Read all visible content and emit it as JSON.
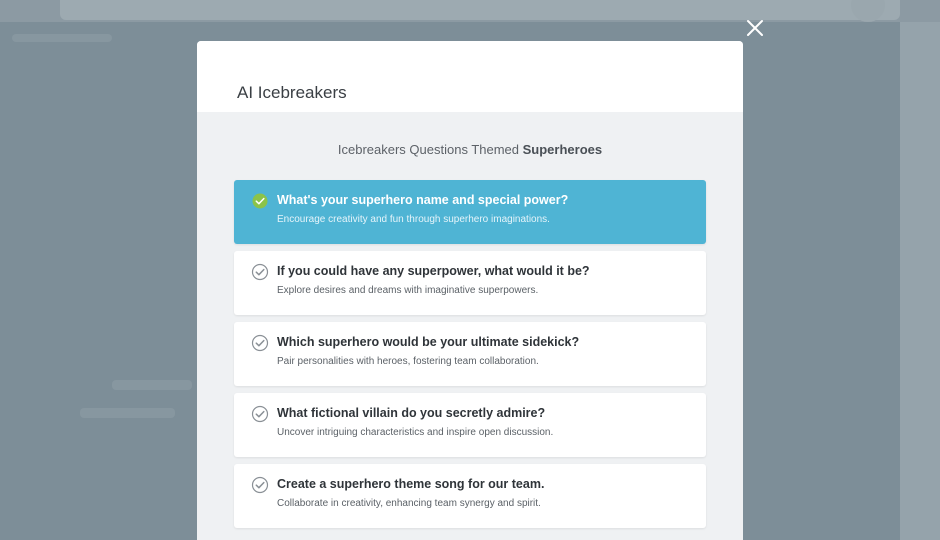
{
  "modal": {
    "title": "AI Icebreakers",
    "subtitle_prefix": "Icebreakers Questions Themed ",
    "subtitle_theme": "Superheroes"
  },
  "questions": [
    {
      "question": "What's your superhero name and special power?",
      "description": "Encourage creativity and fun through superhero imaginations.",
      "selected": true
    },
    {
      "question": "If you could have any superpower, what would it be?",
      "description": "Explore desires and dreams with imaginative superpowers.",
      "selected": false
    },
    {
      "question": "Which superhero would be your ultimate sidekick?",
      "description": "Pair personalities with heroes, fostering team collaboration.",
      "selected": false
    },
    {
      "question": "What fictional villain do you secretly admire?",
      "description": "Uncover intriguing characteristics and inspire open discussion.",
      "selected": false
    },
    {
      "question": "Create a superhero theme song for our team.",
      "description": "Collaborate in creativity, enhancing team synergy and spirit.",
      "selected": false
    }
  ],
  "colors": {
    "selected_card": "#4fb4d4",
    "check_selected": "#8bc34a"
  },
  "icons": {
    "close": "close-icon",
    "check": "check-circle-icon"
  }
}
